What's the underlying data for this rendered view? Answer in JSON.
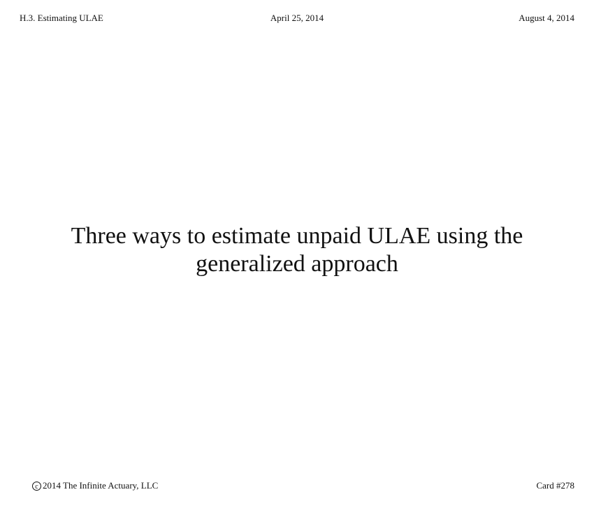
{
  "header": {
    "section": "H.3. Estimating ULAE",
    "created_date": "April 25, 2014",
    "updated_date": "August 4, 2014"
  },
  "card": {
    "question": "Three ways to estimate unpaid ULAE using the generalized approach"
  },
  "footer": {
    "copyright_symbol": "c",
    "copyright": "2014 The Infinite Actuary, LLC",
    "card_number": "Card #278"
  }
}
